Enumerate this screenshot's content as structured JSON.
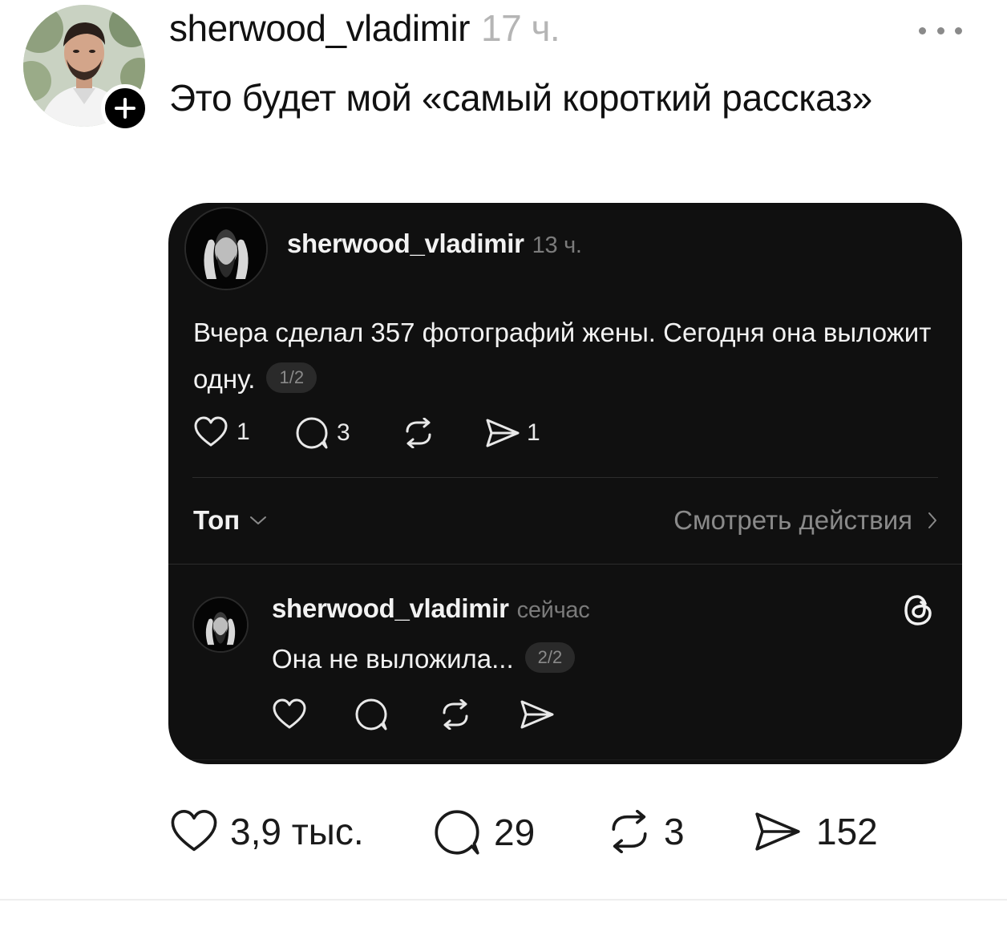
{
  "post": {
    "username": "sherwood_vladimir",
    "time": "17 ч.",
    "text": "Это будет мой «самый короткий рассказ»",
    "more_icon": "more-horizontal-icon",
    "follow_icon": "plus-icon"
  },
  "quoted": {
    "username": "sherwood_vladimir",
    "time": "13 ч.",
    "text": "Вчера сделал 357 фотографий жены. Сегодня она выложит одну.",
    "page": "1/2",
    "actions": {
      "likes": "1",
      "comments": "3",
      "shares": "1"
    },
    "sort_label": "Топ",
    "view_activity": "Смотреть действия",
    "reply": {
      "username": "sherwood_vladimir",
      "time": "сейчас",
      "text": "Она не выложила...",
      "page": "2/2",
      "brand_icon": "threads-logo-icon"
    }
  },
  "actions": {
    "likes": "3,9 тыс.",
    "comments": "29",
    "reposts": "3",
    "shares": "152"
  },
  "colors": {
    "card_background": "#101010",
    "muted_text": "#8a8a8a",
    "time_light": "#b5b5b5"
  }
}
